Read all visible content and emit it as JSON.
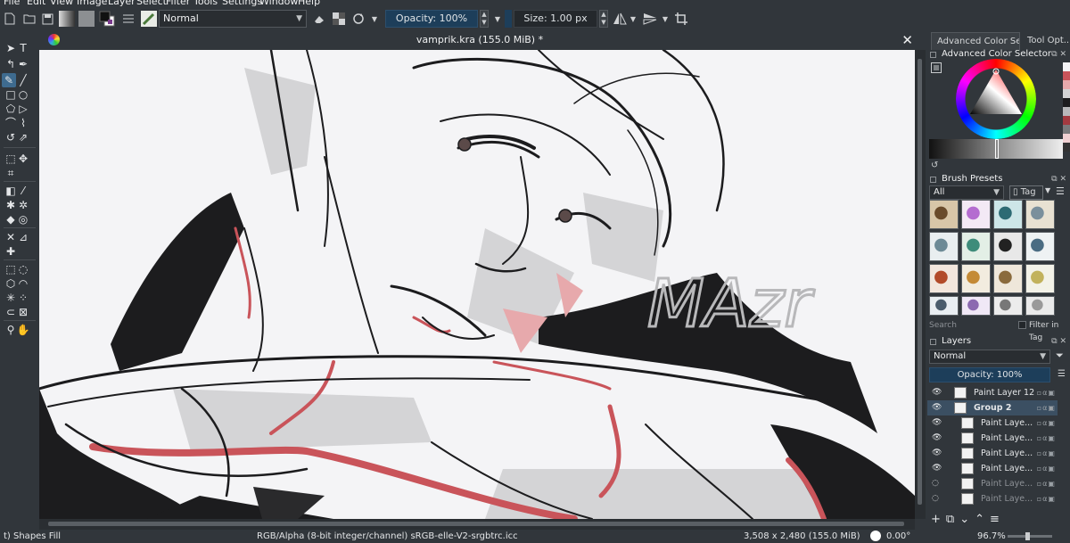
{
  "menu": [
    "File",
    "Edit",
    "View",
    "Image",
    "Layer",
    "Select",
    "Filter",
    "Tools",
    "Settings",
    "Window",
    "Help"
  ],
  "tool_options": {
    "blend_mode": "Normal",
    "opacity_label": "Opacity: 100%",
    "size_label": "Size: 1.00 px"
  },
  "document": {
    "title": "vamprik.kra (155.0 MiB) *",
    "signature_text": "MAzr"
  },
  "dockers": {
    "tabs": [
      "Advanced Color Sel...",
      "Tool Opt..."
    ],
    "color_selector_title": "Advanced Color Selector",
    "brush_presets_title": "Brush Presets",
    "brush_filter": "All",
    "tag_label": "Tag",
    "search_placeholder": "Search",
    "filter_in_tag": "Filter in Tag",
    "layers_title": "Layers",
    "layer_blend_mode": "Normal",
    "layer_opacity_label": "Opacity:  100%"
  },
  "layers": [
    {
      "name": "Paint Layer 12",
      "visible": true,
      "indent": 0,
      "selected": false
    },
    {
      "name": "Group 2",
      "visible": true,
      "indent": 0,
      "selected": true
    },
    {
      "name": "Paint Laye...",
      "visible": true,
      "indent": 1,
      "selected": false
    },
    {
      "name": "Paint Laye...",
      "visible": true,
      "indent": 1,
      "selected": false
    },
    {
      "name": "Paint Laye...",
      "visible": true,
      "indent": 1,
      "selected": false
    },
    {
      "name": "Paint Laye...",
      "visible": true,
      "indent": 1,
      "selected": false
    },
    {
      "name": "Paint Laye...",
      "visible": false,
      "indent": 1,
      "selected": false
    },
    {
      "name": "Paint Laye...",
      "visible": false,
      "indent": 1,
      "selected": false
    }
  ],
  "status": {
    "tool": "t) Shapes Fill",
    "colorspace": "RGB/Alpha (8-bit integer/channel)  sRGB-elle-V2-srgbtrc.icc",
    "dimensions": "3,508 x 2,480 (155.0 MiB)",
    "rotation": "0.00°",
    "zoom": "96.7%"
  },
  "colors": {
    "ui_bg": "#31363b",
    "canvas_bg": "#f4f4f6",
    "accent": "#3e6b8f",
    "ink": "#1c1c1e",
    "blood_red": "#c9545a"
  }
}
